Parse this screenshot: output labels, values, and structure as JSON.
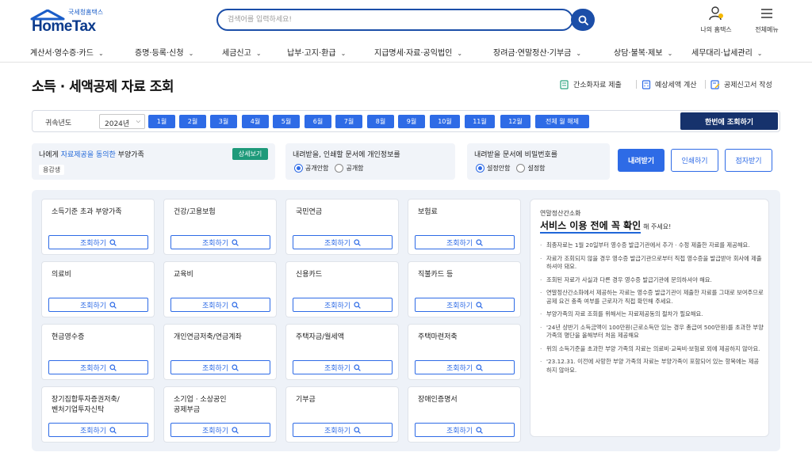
{
  "header": {
    "logo_sub": "국세청홈택스",
    "logo_main": "HomeTax",
    "search_placeholder": "검색어를 입력하세요!",
    "my_hometax": "나의 홈택스",
    "all_menu": "전체메뉴"
  },
  "nav": [
    "계산서·영수증·카드",
    "증명·등록·신청",
    "세금신고",
    "납부·고지·환급",
    "지급명세·자료·공익법인",
    "장려금·연말정산·기부금",
    "상담·불복·제보",
    "세무대리·납세관리"
  ],
  "page": {
    "title": "소득 · 세액공제 자료 조회",
    "quick_links": [
      "간소화자료 제출",
      "예상세액 계산",
      "공제신고서 작성"
    ]
  },
  "year_bar": {
    "label": "귀속년도",
    "selected_year": "2024년",
    "months": [
      "1월",
      "2월",
      "3월",
      "4월",
      "5월",
      "6월",
      "7월",
      "8월",
      "9월",
      "10월",
      "11월",
      "12월"
    ],
    "all_month_clear": "전체 월 해제",
    "query_all": "한번에 조회하기"
  },
  "options": {
    "dependents": {
      "title_pre": "나에게 ",
      "title_highlight": "자료제공을 동의한",
      "title_post": " 부양가족",
      "chip": "용감생",
      "detail_button": "상세보기"
    },
    "privacy": {
      "title": "내려받을, 인쇄할 문서에 개인정보를",
      "opt1": "공개안함",
      "opt2": "공개함"
    },
    "password": {
      "title": "내려받을 문서에 비밀번호를",
      "opt1": "설정안함",
      "opt2": "설정함"
    },
    "buttons": {
      "download": "내려받기",
      "print": "인쇄하기",
      "braille": "점자받기"
    }
  },
  "cards": [
    {
      "title": "소득기준 초과 부양가족",
      "button": "조회하기"
    },
    {
      "title": "건강/고용보험",
      "button": "조회하기"
    },
    {
      "title": "국민연금",
      "button": "조회하기"
    },
    {
      "title": "보험료",
      "button": "조회하기"
    },
    {
      "title": "의료비",
      "button": "조회하기"
    },
    {
      "title": "교육비",
      "button": "조회하기"
    },
    {
      "title": "신용카드",
      "button": "조회하기"
    },
    {
      "title": "직불카드 등",
      "button": "조회하기"
    },
    {
      "title": "현금영수증",
      "button": "조회하기"
    },
    {
      "title": "개인연금저축/연금계좌",
      "button": "조회하기"
    },
    {
      "title": "주택자금/월세액",
      "button": "조회하기"
    },
    {
      "title": "주택마련저축",
      "button": "조회하기"
    },
    {
      "title": "장기집합투자증권저축/\n벤처기업투자신탁",
      "button": "조회하기"
    },
    {
      "title": "소기업 · 소상공인\n공제부금",
      "button": "조회하기"
    },
    {
      "title": "기부금",
      "button": "조회하기"
    },
    {
      "title": "장애인증명서",
      "button": "조회하기"
    }
  ],
  "notice": {
    "sub": "연말정산간소화",
    "title": "서비스 이용 전에 꼭 확인",
    "title_suffix": "해 주세요!",
    "items": [
      "최종자료는 1월 20일부터 영수증 발급기관에서 추가 · 수정 제출한 자료를 제공해요.",
      "자료가 조회되지 않을 경우 영수증 발급기관으로부터 직접 영수증을 발급받아 회사에 제출하셔야 돼요.",
      "조회된 자료가 사실과 다른 경우 영수증 발급기관에 문의하셔야 해요.",
      "연말정산간소화에서 제공하는 자료는 영수증 발급기관이 제출한 자료를 그대로 보여주므로 공제 요건 충족 여부를 근로자가 직접 확인해 주세요.",
      "부양가족의 자료 조회를 위해서는 자료제공동의 절차가 필요해요.",
      "'24년 상반기 소득금액이 100만원(근로소득만 있는 경우 총급여 500만원)를 초과한 부양가족의 명단을 올해부터 처음 제공해요",
      "위의 소득기준을 초과한 부양 가족의 자료는 의료비·교육비·보험료 외에 제공하지 않아요.",
      "'23.12.31. 이전에 사망한 부양 가족의 자료는 부양가족이 포함되어 있는 항목에는 제공하지 않아요."
    ]
  },
  "colors": {
    "primary": "#2e6be6",
    "navy": "#16326c",
    "green": "#1e9a7a",
    "panel_bg": "#eef2f8"
  }
}
